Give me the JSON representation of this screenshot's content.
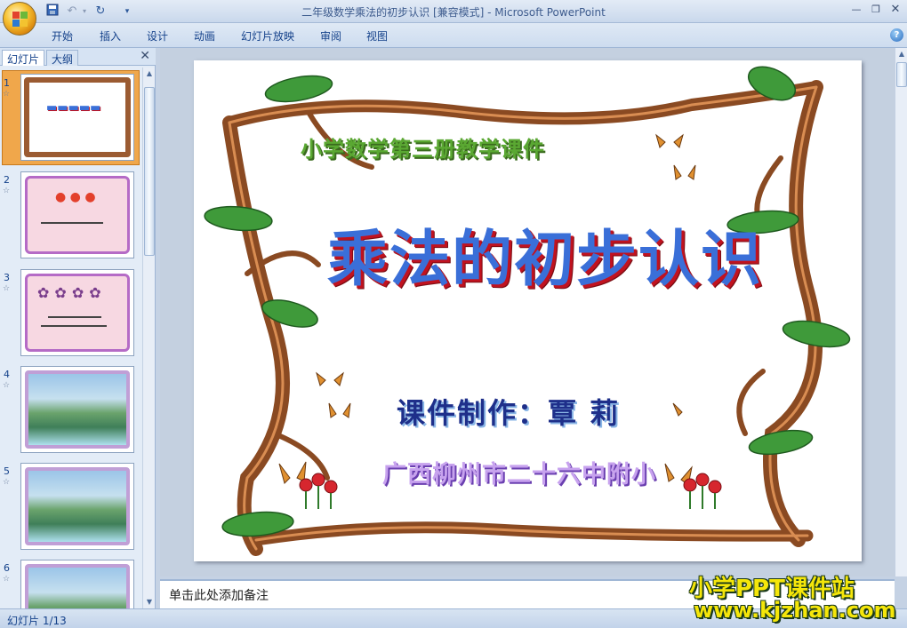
{
  "window": {
    "title": "二年级数学乘法的初步认识 [兼容模式] - Microsoft PowerPoint"
  },
  "ribbon_tabs": [
    "开始",
    "插入",
    "设计",
    "动画",
    "幻灯片放映",
    "审阅",
    "视图"
  ],
  "left_pane": {
    "tabs": [
      "幻灯片",
      "大纲"
    ],
    "slides": [
      {
        "number": "1",
        "selected": true
      },
      {
        "number": "2",
        "selected": false
      },
      {
        "number": "3",
        "selected": false
      },
      {
        "number": "4",
        "selected": false
      },
      {
        "number": "5",
        "selected": false
      },
      {
        "number": "6",
        "selected": false
      }
    ]
  },
  "slide": {
    "subject": "小学数学第三册教学课件",
    "title": "乘法的初步认识",
    "author": "课件制作：覃 莉",
    "school": "广西柳州市二十六中附小"
  },
  "notes": {
    "placeholder": "单击此处添加备注"
  },
  "status": {
    "slide_counter": "幻灯片 1/13"
  },
  "watermark": {
    "title": "小学PPT课件站",
    "url": "www.kjzhan.com"
  },
  "colors": {
    "accent": "#15428b",
    "title_blue": "#3a6fd8",
    "frame_brown": "#9b5b32"
  }
}
